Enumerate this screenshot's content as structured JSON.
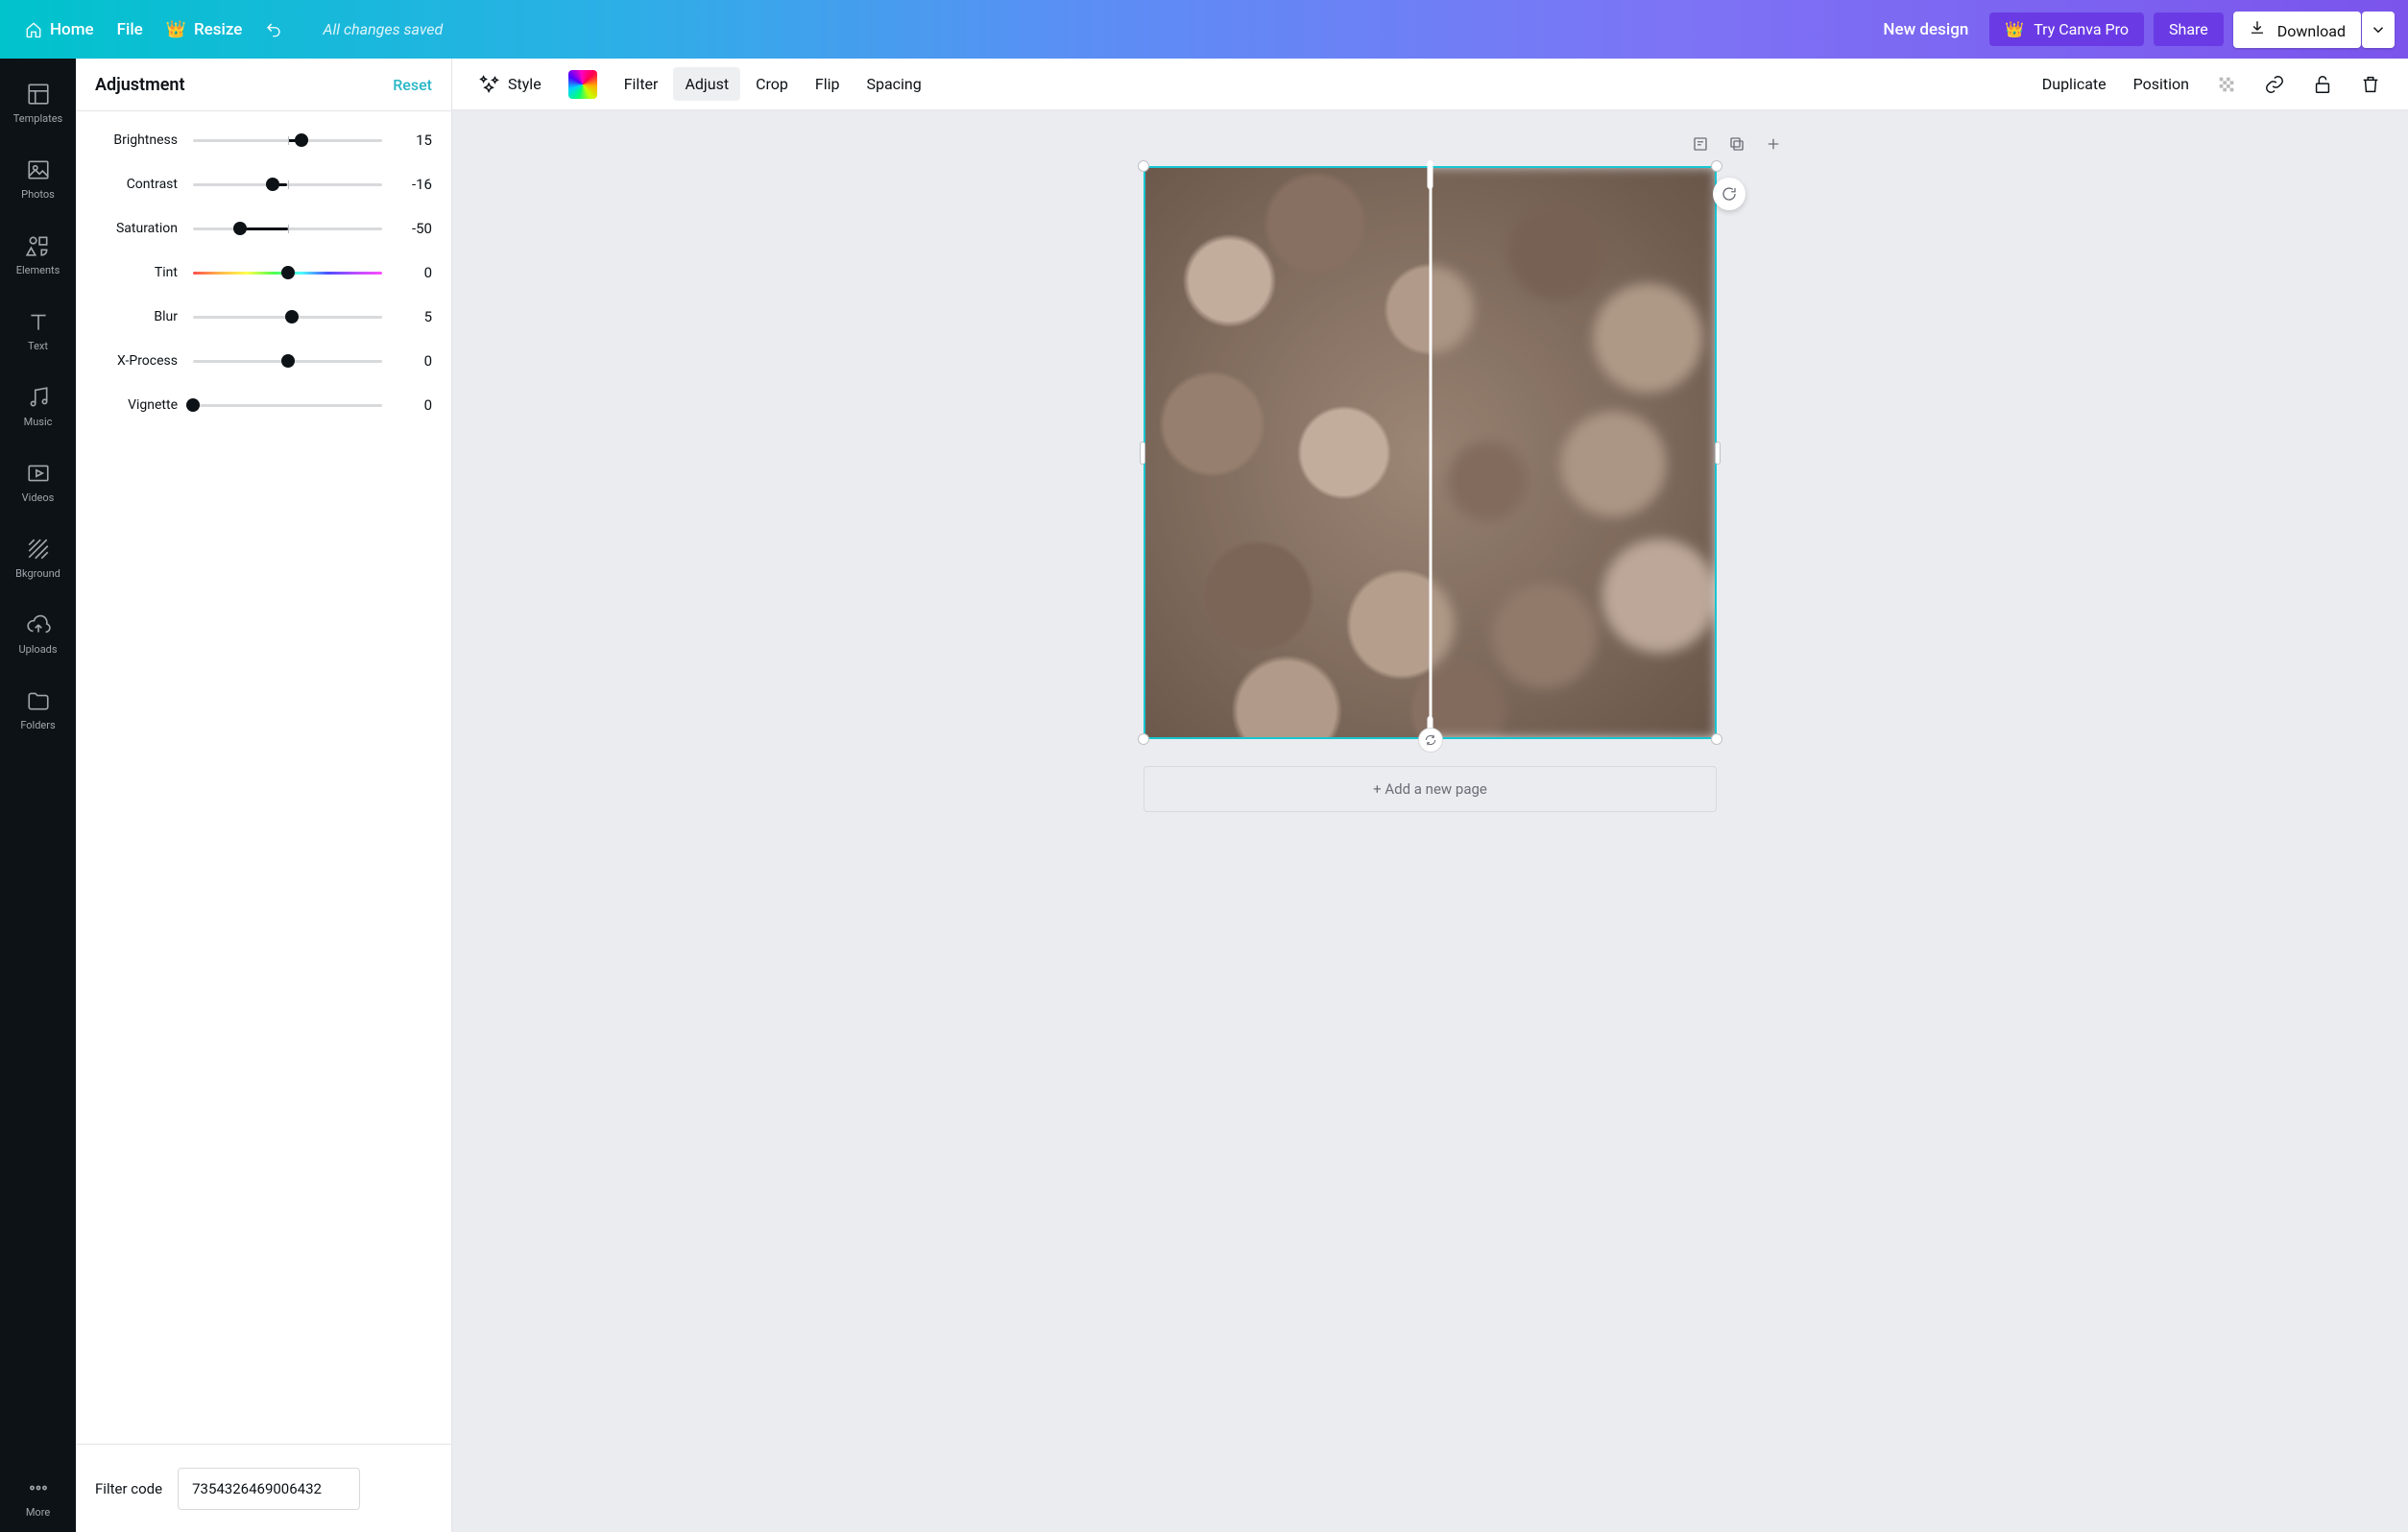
{
  "header": {
    "home": "Home",
    "file": "File",
    "resize": "Resize",
    "status": "All changes saved",
    "new_design": "New design",
    "try_pro": "Try Canva Pro",
    "share": "Share",
    "download": "Download"
  },
  "rail": {
    "items": [
      {
        "key": "templates",
        "label": "Templates"
      },
      {
        "key": "photos",
        "label": "Photos"
      },
      {
        "key": "elements",
        "label": "Elements"
      },
      {
        "key": "text",
        "label": "Text"
      },
      {
        "key": "music",
        "label": "Music"
      },
      {
        "key": "videos",
        "label": "Videos"
      },
      {
        "key": "bkground",
        "label": "Bkground"
      },
      {
        "key": "uploads",
        "label": "Uploads"
      },
      {
        "key": "folders",
        "label": "Folders"
      }
    ],
    "more": "More"
  },
  "panel": {
    "title": "Adjustment",
    "reset": "Reset",
    "sliders": [
      {
        "key": "brightness",
        "label": "Brightness",
        "value": 15,
        "min": -100,
        "max": 100
      },
      {
        "key": "contrast",
        "label": "Contrast",
        "value": -16,
        "min": -100,
        "max": 100
      },
      {
        "key": "saturation",
        "label": "Saturation",
        "value": -50,
        "min": -100,
        "max": 100
      },
      {
        "key": "tint",
        "label": "Tint",
        "value": 0,
        "min": -100,
        "max": 100,
        "rainbow": true,
        "notick": true
      },
      {
        "key": "blur",
        "label": "Blur",
        "value": 5,
        "min": -100,
        "max": 100
      },
      {
        "key": "xprocess",
        "label": "X-Process",
        "value": 0,
        "min": -100,
        "max": 100
      },
      {
        "key": "vignette",
        "label": "Vignette",
        "value": 0,
        "min": 0,
        "max": 100,
        "notick": true
      }
    ],
    "filter_code_label": "Filter code",
    "filter_code": "7354326469006432"
  },
  "toolbar": {
    "style": "Style",
    "filter": "Filter",
    "adjust": "Adjust",
    "crop": "Crop",
    "flip": "Flip",
    "spacing": "Spacing",
    "duplicate": "Duplicate",
    "position": "Position"
  },
  "canvas": {
    "add_page": "+ Add a new page"
  }
}
